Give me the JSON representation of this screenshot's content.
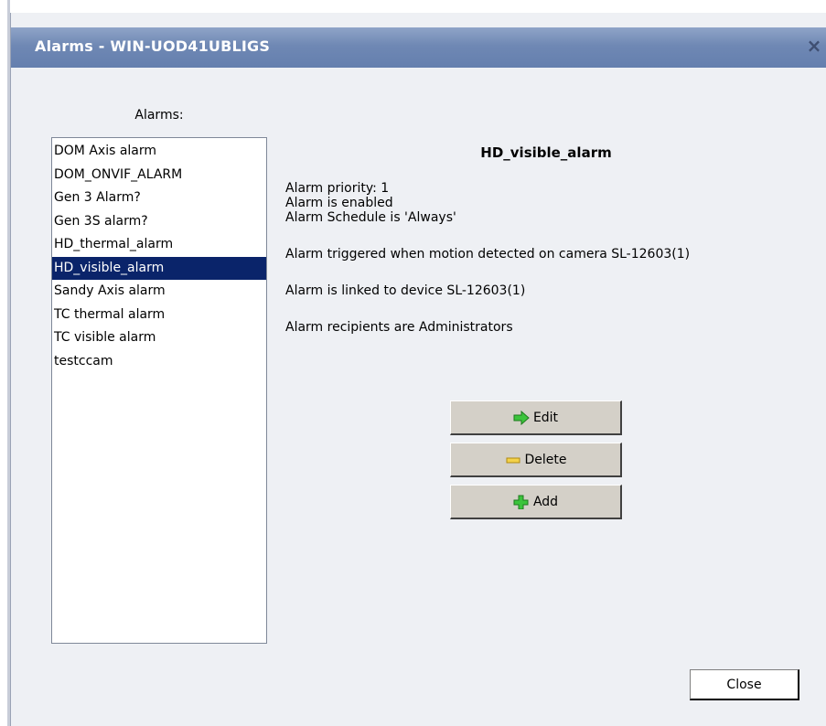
{
  "window": {
    "title": "Alarms - WIN-UOD41UBLIGS",
    "close_glyph": "×"
  },
  "alarm_list": {
    "label": "Alarms:",
    "items": [
      "DOM Axis alarm",
      "DOM_ONVIF_ALARM",
      "Gen 3 Alarm?",
      "Gen 3S alarm?",
      "HD_thermal_alarm",
      "HD_visible_alarm",
      "Sandy Axis alarm",
      "TC thermal alarm",
      "TC visible alarm",
      "testccam"
    ],
    "selected": "HD_visible_alarm"
  },
  "details": {
    "title": "HD_visible_alarm",
    "priority": "Alarm priority: 1",
    "enabled": "Alarm is enabled",
    "schedule": "Alarm Schedule is 'Always'",
    "trigger": "Alarm triggered when motion detected on camera SL-12603(1)",
    "linked": "Alarm is linked to device SL-12603(1)",
    "recipients": "Alarm recipients are Administrators"
  },
  "actions": {
    "edit_label": "Edit",
    "delete_label": "Delete",
    "add_label": "Add",
    "close_label": "Close"
  },
  "icons": {
    "edit": "green-arrow-right-icon",
    "delete": "yellow-minus-icon",
    "add": "green-plus-icon"
  },
  "colors": {
    "titlebar": "#6f88b4",
    "selection": "#0a246a",
    "dialog_bg": "#eef0f4",
    "button_bg": "#d4d0c8"
  }
}
